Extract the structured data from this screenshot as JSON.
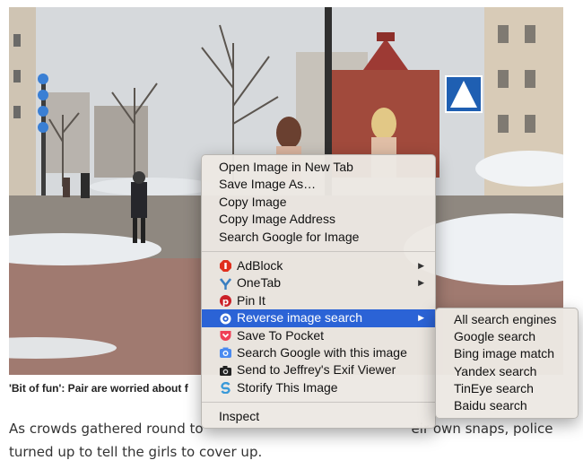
{
  "article": {
    "caption": "'Bit of fun': Pair are worried about f",
    "body_line1": "As crowds gathered round to",
    "body_line1_tail": "eir own snaps, police",
    "body_line2": "turned up to tell the girls to cover up."
  },
  "context_menu": {
    "group1": [
      "Open Image in New Tab",
      "Save Image As…",
      "Copy Image",
      "Copy Image Address",
      "Search Google for Image"
    ],
    "group2": [
      {
        "label": "AdBlock",
        "icon": "adblock-icon",
        "has_submenu": true
      },
      {
        "label": "OneTab",
        "icon": "onetab-icon",
        "has_submenu": true
      },
      {
        "label": "Pin It",
        "icon": "pinterest-icon",
        "has_submenu": false
      },
      {
        "label": "Reverse image search",
        "icon": "reverse-search-icon",
        "has_submenu": true,
        "selected": true
      },
      {
        "label": "Save To Pocket",
        "icon": "pocket-icon",
        "has_submenu": false
      },
      {
        "label": "Search Google with this image",
        "icon": "camera-search-icon",
        "has_submenu": false
      },
      {
        "label": "Send to Jeffrey's Exif Viewer",
        "icon": "camera-icon",
        "has_submenu": false
      },
      {
        "label": "Storify This Image",
        "icon": "storify-icon",
        "has_submenu": false
      }
    ],
    "group3": [
      "Inspect"
    ],
    "submenu_arrow": "▶"
  },
  "submenu": {
    "items": [
      "All search engines",
      "Google search",
      "Bing image match",
      "Yandex search",
      "TinEye search",
      "Baidu search"
    ]
  },
  "colors": {
    "selected_bg": "#2b63d6",
    "adblock": "#e0301e",
    "onetab": "#3a7fc1",
    "pinterest": "#cb2027",
    "pocket": "#ef4056",
    "storify": "#3a9ad9"
  }
}
